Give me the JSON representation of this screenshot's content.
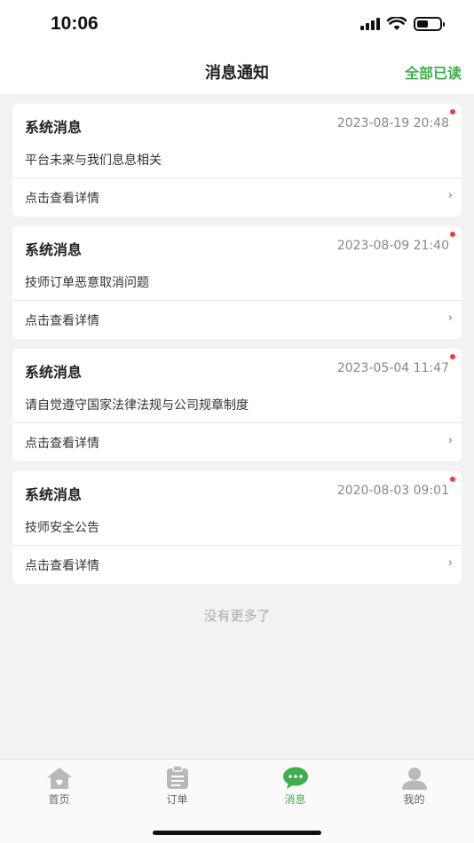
{
  "status_bar": {
    "time": "10:06"
  },
  "header": {
    "title": "消息通知",
    "mark_all_read": "全部已读"
  },
  "messages": [
    {
      "title": "系统消息",
      "time": "2023-08-19 20:48",
      "content": "平台未来与我们息息相关",
      "link": "点击查看详情",
      "unread": true
    },
    {
      "title": "系统消息",
      "time": "2023-08-09 21:40",
      "content": "技师订单恶意取消问题",
      "link": "点击查看详情",
      "unread": true
    },
    {
      "title": "系统消息",
      "time": "2023-05-04 11:47",
      "content": "请自觉遵守国家法律法规与公司规章制度",
      "link": "点击查看详情",
      "unread": true
    },
    {
      "title": "系统消息",
      "time": "2020-08-03 09:01",
      "content": "技师安全公告",
      "link": "点击查看详情",
      "unread": true
    }
  ],
  "list_footer": "没有更多了",
  "tabs": [
    {
      "label": "首页",
      "icon": "home-icon",
      "active": false
    },
    {
      "label": "订单",
      "icon": "clipboard-icon",
      "active": false
    },
    {
      "label": "消息",
      "icon": "chat-bubble-icon",
      "active": true
    },
    {
      "label": "我的",
      "icon": "user-icon",
      "active": false
    }
  ],
  "colors": {
    "accent": "#3fae4c",
    "unread_dot": "#e84141",
    "background": "#f2f2f2"
  }
}
